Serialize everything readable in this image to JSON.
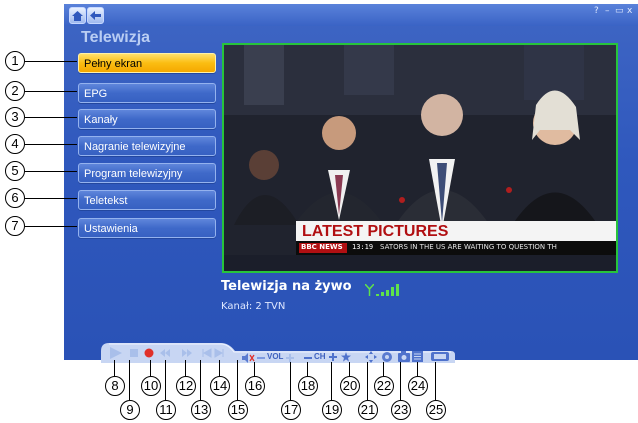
{
  "app": {
    "title": "Telewizja",
    "window_controls": [
      "?",
      "–",
      "▭",
      "x"
    ]
  },
  "menu": {
    "items": [
      {
        "label": "Pełny ekran",
        "active": true
      },
      {
        "label": "EPG",
        "active": false
      },
      {
        "label": "Kanały",
        "active": false
      },
      {
        "label": "Nagranie telewizyjne",
        "active": false
      },
      {
        "label": "Program telewizyjny",
        "active": false
      },
      {
        "label": "Teletekst",
        "active": false
      },
      {
        "label": "Ustawienia",
        "active": false
      }
    ]
  },
  "video": {
    "headline": "LATEST PICTURES",
    "channel_logo": "BBC NEWS",
    "clock": "13:19",
    "ticker": "SATORS IN THE US ARE WAITING TO QUESTION TH"
  },
  "info": {
    "title": "Telewizja na żywo",
    "channel": "Kanał: 2 TVN",
    "signal_level": 5
  },
  "controls": {
    "vol_label": "VOL",
    "ch_label": "CH",
    "icons": [
      "play-icon",
      "stop-icon",
      "record-icon",
      "rewind-icon",
      "fast-forward-icon",
      "previous-icon",
      "next-icon",
      "mute-icon",
      "volume-up-icon",
      "channel-down-icon",
      "channel-up-icon",
      "favorite-icon",
      "fullscreen-icon",
      "audio-icon",
      "snapshot-icon",
      "teletext-icon",
      "tv-icon"
    ]
  },
  "callouts": {
    "left": [
      "1",
      "2",
      "3",
      "4",
      "5",
      "6",
      "7"
    ],
    "bottom": [
      "8",
      "9",
      "10",
      "11",
      "12",
      "13",
      "14",
      "15",
      "16",
      "17",
      "18",
      "19",
      "20",
      "21",
      "22",
      "23",
      "24",
      "25"
    ]
  },
  "colors": {
    "app_bg": "#2f58bd",
    "active_item": "#fbbd12",
    "video_border": "#27c43b",
    "signal": "#5fe24a"
  }
}
